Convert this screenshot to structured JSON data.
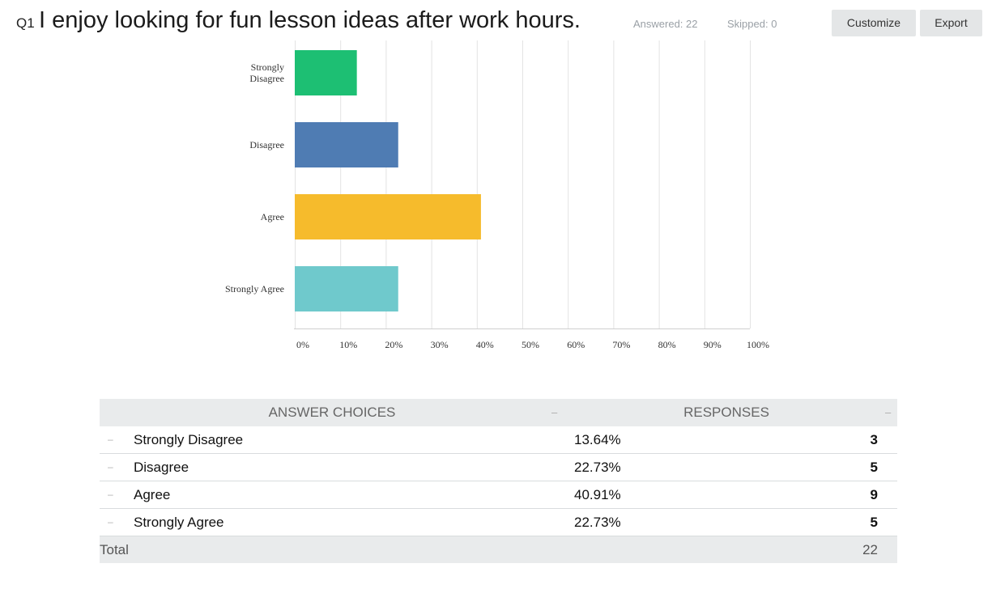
{
  "question": {
    "number": "Q1",
    "title": "I enjoy looking for fun lesson ideas after work hours.",
    "answered": "Answered: 22",
    "skipped": "Skipped: 0"
  },
  "toolbar": {
    "customize_label": "Customize",
    "export_label": "Export"
  },
  "colors": {
    "strongly_disagree": "#1dbf73",
    "disagree": "#4f7cb3",
    "agree": "#f6bb2c",
    "strongly_agree": "#6fc9cc",
    "gridline": "#e3e3e3"
  },
  "chart_data": {
    "type": "bar",
    "orientation": "horizontal",
    "categories": [
      "Strongly Disagree",
      "Disagree",
      "Agree",
      "Strongly Agree"
    ],
    "category_labels": [
      [
        "Strongly",
        "Disagree"
      ],
      [
        "Disagree"
      ],
      [
        "Agree"
      ],
      [
        "Strongly Agree"
      ]
    ],
    "values": [
      13.64,
      22.73,
      40.91,
      22.73
    ],
    "bar_colors": [
      "#1dbf73",
      "#4f7cb3",
      "#f6bb2c",
      "#6fc9cc"
    ],
    "xlim": [
      0,
      100
    ],
    "xticks": [
      "0%",
      "10%",
      "20%",
      "30%",
      "40%",
      "50%",
      "60%",
      "70%",
      "80%",
      "90%",
      "100%"
    ],
    "grid": true
  },
  "table": {
    "headers": {
      "choices": "ANSWER CHOICES",
      "responses": "RESPONSES",
      "dash": "–"
    },
    "rows": [
      {
        "dash": "–",
        "choice": "Strongly Disagree",
        "percent": "13.64%",
        "count": "3"
      },
      {
        "dash": "–",
        "choice": "Disagree",
        "percent": "22.73%",
        "count": "5"
      },
      {
        "dash": "–",
        "choice": "Agree",
        "percent": "40.91%",
        "count": "9"
      },
      {
        "dash": "–",
        "choice": "Strongly Agree",
        "percent": "22.73%",
        "count": "5"
      }
    ],
    "total_label": "Total",
    "total_value": "22"
  }
}
